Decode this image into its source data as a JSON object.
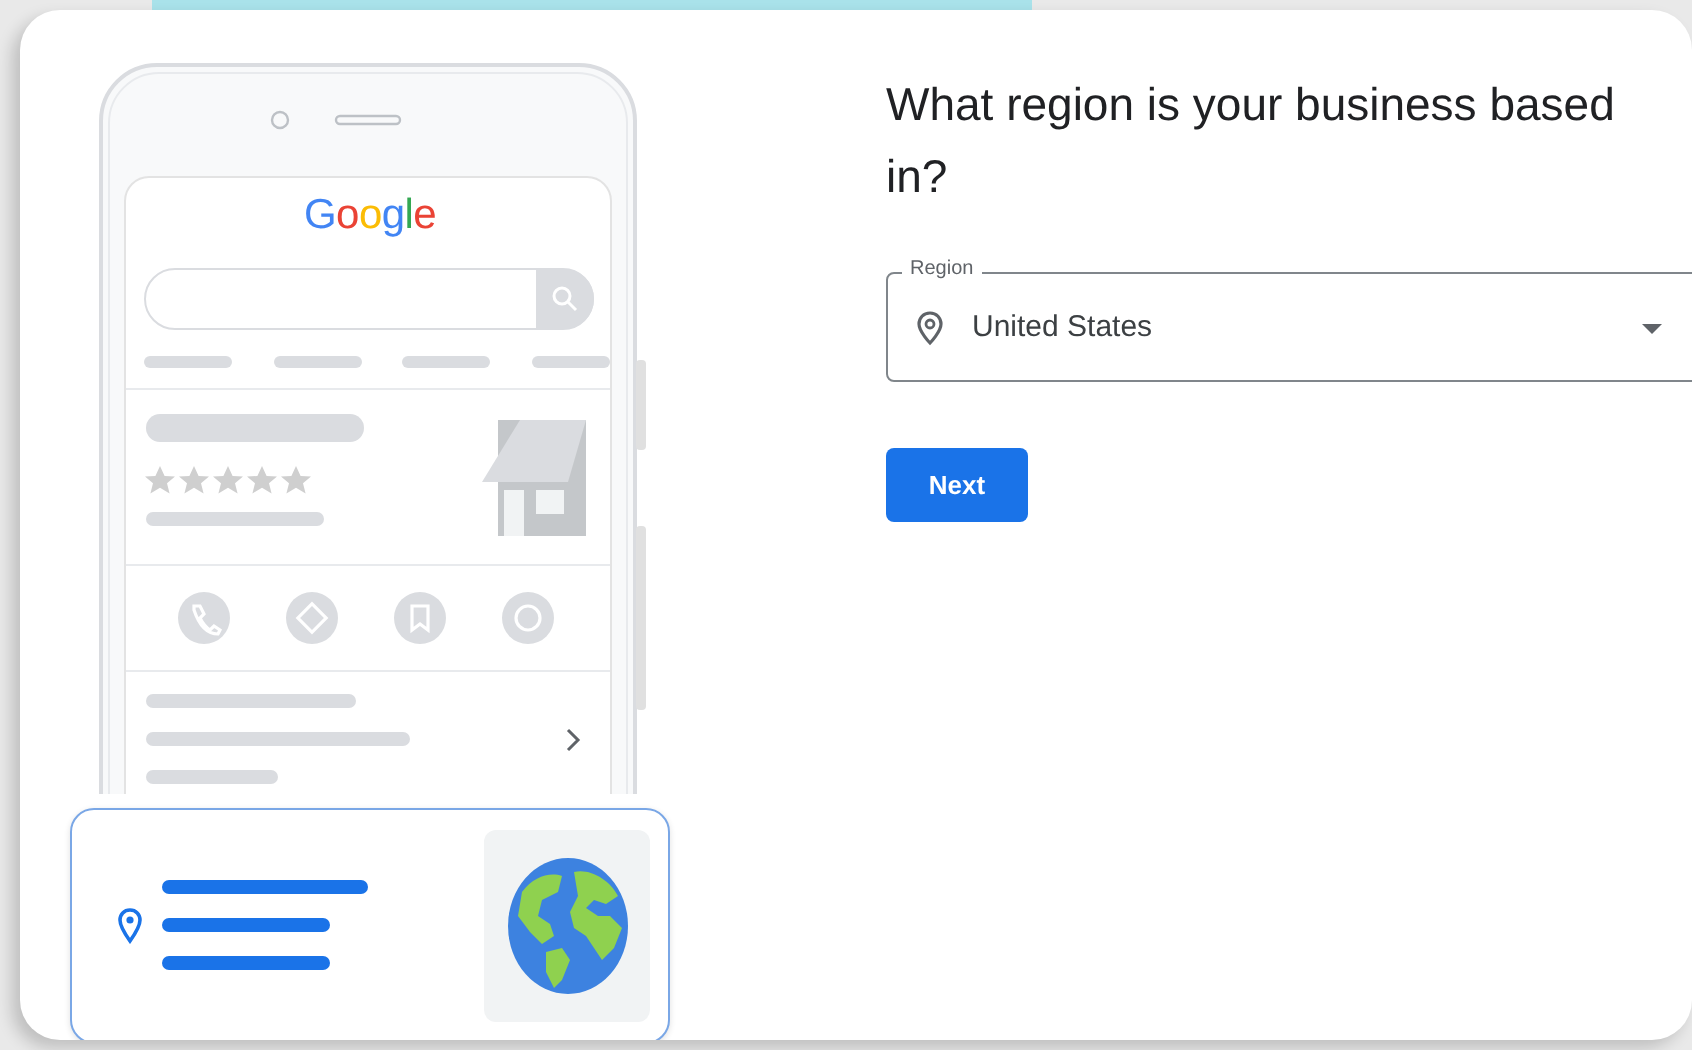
{
  "illustration": {
    "logo": "Google"
  },
  "heading": "What region is your business based in?",
  "region_field": {
    "label": "Region",
    "value": "United States"
  },
  "next_button": {
    "label": "Next"
  }
}
